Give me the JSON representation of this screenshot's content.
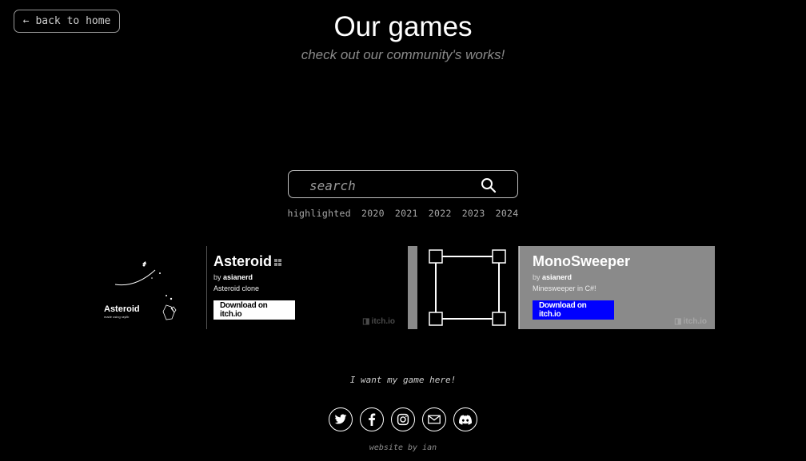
{
  "nav": {
    "back_label": "back to home"
  },
  "header": {
    "title": "Our games",
    "subtitle": "check out our community's works!"
  },
  "search": {
    "placeholder": "search",
    "value": ""
  },
  "filters": [
    "highlighted",
    "2020",
    "2021",
    "2022",
    "2023",
    "2024"
  ],
  "games": [
    {
      "title": "Asteroid",
      "author_prefix": "by",
      "author": "asianerd",
      "description": "Asteroid clone",
      "download_label": "Download on itch.io",
      "thumb_title": "Asteroid",
      "thumb_sub": "made using raylib",
      "itch_label": "itch.io",
      "platform_icon": "windows-icon"
    },
    {
      "title": "MonoSweeper",
      "author_prefix": "by",
      "author": "asianerd",
      "description": "Minesweeper in C#!",
      "download_label": "Download on itch.io",
      "itch_label": "itch.io",
      "accent": "#0000ff",
      "card_bg": "#8a8a8a"
    }
  ],
  "cta": "I want my game here!",
  "socials": [
    "twitter-icon",
    "facebook-icon",
    "instagram-icon",
    "email-icon",
    "discord-icon"
  ],
  "footer": {
    "credit": "website by ian"
  }
}
